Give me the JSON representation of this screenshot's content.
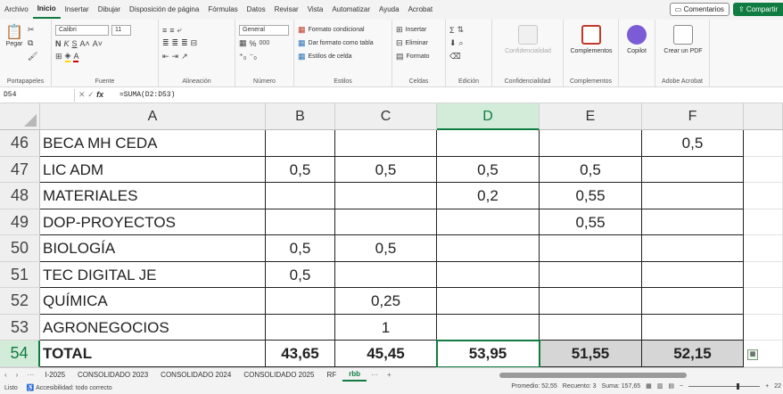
{
  "menu": {
    "tabs": [
      "Archivo",
      "Inicio",
      "Insertar",
      "Dibujar",
      "Disposición de página",
      "Fórmulas",
      "Datos",
      "Revisar",
      "Vista",
      "Automatizar",
      "Ayuda",
      "Acrobat"
    ],
    "active_tab": "Inicio",
    "comments_label": "Comentarios",
    "share_label": "Compartir"
  },
  "ribbon": {
    "clipboard": {
      "label": "Portapapeles",
      "paste": "Pegar"
    },
    "font": {
      "label": "Fuente",
      "name": "Calibri",
      "size": "11"
    },
    "alignment": {
      "label": "Alineación"
    },
    "number": {
      "label": "Número",
      "format": "General",
      "percent": "%",
      "thousands": "000"
    },
    "styles": {
      "label": "Estilos",
      "conditional": "Formato condicional",
      "as_table": "Dar formato como tabla",
      "cell_styles": "Estilos de celda"
    },
    "cells": {
      "label": "Celdas",
      "insert": "Insertar",
      "delete": "Eliminar",
      "format": "Formato"
    },
    "editing": {
      "label": "Edición"
    },
    "sensitivity": {
      "label": "Confidencialidad",
      "btn": "Confidencialidad"
    },
    "addins": {
      "label": "Complementos",
      "btn": "Complementos"
    },
    "copilot": {
      "btn": "Copilot"
    },
    "acrobat": {
      "label": "Adobe Acrobat",
      "btn": "Crear un PDF"
    }
  },
  "formula_bar": {
    "name_box": "D54",
    "fx": "fx",
    "formula": "=SUMA(D2:D53)"
  },
  "grid": {
    "columns": [
      "A",
      "B",
      "C",
      "D",
      "E",
      "F"
    ],
    "selected_column": "D",
    "rows": [
      {
        "num": "46",
        "a": "BECA MH CEDA",
        "b": "",
        "c": "",
        "d": "",
        "e": "",
        "f": "0,5"
      },
      {
        "num": "47",
        "a": "LIC ADM",
        "b": "0,5",
        "c": "0,5",
        "d": "0,5",
        "e": "0,5",
        "f": ""
      },
      {
        "num": "48",
        "a": "MATERIALES",
        "b": "",
        "c": "",
        "d": "0,2",
        "e": "0,55",
        "f": ""
      },
      {
        "num": "49",
        "a": "DOP-PROYECTOS",
        "b": "",
        "c": "",
        "d": "",
        "e": "0,55",
        "f": ""
      },
      {
        "num": "50",
        "a": "BIOLOGÍA",
        "b": "0,5",
        "c": "0,5",
        "d": "",
        "e": "",
        "f": ""
      },
      {
        "num": "51",
        "a": "TEC DIGITAL JE",
        "b": "0,5",
        "c": "",
        "d": "",
        "e": "",
        "f": ""
      },
      {
        "num": "52",
        "a": "QUÍMICA",
        "b": "",
        "c": "0,25",
        "d": "",
        "e": "",
        "f": ""
      },
      {
        "num": "53",
        "a": "AGRONEGOCIOS",
        "b": "",
        "c": "1",
        "d": "",
        "e": "",
        "f": ""
      },
      {
        "num": "54",
        "a": "TOTAL",
        "b": "43,65",
        "c": "45,45",
        "d": "53,95",
        "e": "51,55",
        "f": "52,15"
      }
    ]
  },
  "sheets": {
    "tabs": [
      "I-2025",
      "CONSOLIDADO 2023",
      "CONSOLIDADO 2024",
      "CONSOLIDADO 2025",
      "RF",
      "rbb"
    ],
    "active": "rbb",
    "more": "···",
    "add": "+"
  },
  "status": {
    "ready": "Listo",
    "accessibility": "Accesibilidad: todo correcto",
    "average": "Promedio: 52,55",
    "count": "Recuento: 3",
    "sum": "Suma: 157,65",
    "zoom": "22"
  },
  "colors": {
    "accent": "#107c41",
    "selection_fill": "#d3ebd9",
    "total_grey": "#d6d6d6"
  }
}
